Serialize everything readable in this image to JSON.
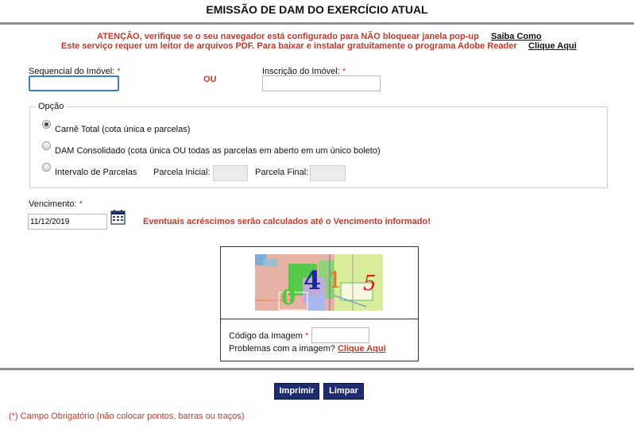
{
  "header": {
    "title": "EMISSÃO DE DAM DO EXERCÍCIO ATUAL"
  },
  "notice": {
    "popup_warning": "ATENÇÃO, verifique se o seu navegador está configurado para NÃO bloquear janela pop-up",
    "popup_link": "Saiba Como",
    "pdf_warning": "Este serviço requer um leitor de arquivos PDF. Para baixar e instalar gratuitamente o programa Adobe Reader",
    "pdf_link": "Clique Aqui"
  },
  "form": {
    "sequencial_label": "Sequencial do Imóvel:",
    "sequencial_value": "",
    "ou_label": "OU",
    "inscricao_label": "Inscrição do Imóvel:",
    "inscricao_value": "",
    "required_mark": "*"
  },
  "opcao": {
    "legend": "Opção",
    "options": [
      {
        "label": "Carnê Total (cota única e parcelas)",
        "checked": true
      },
      {
        "label": "DAM Consolidado (cota única OU todas as parcelas em aberto em um único boleto)",
        "checked": false
      },
      {
        "label": "Intervalo de Parcelas",
        "checked": false
      }
    ],
    "parcela_inicial_label": "Parcela Inicial:",
    "parcela_final_label": "Parcela Final:"
  },
  "vencimento": {
    "label": "Vencimento:",
    "value": "11/12/2019",
    "note": "Eventuais acréscimos serão calculados até o Vencimento informado!",
    "calendar_icon": "calendar-icon"
  },
  "captcha": {
    "digits": [
      "0",
      "4",
      "1",
      "5"
    ],
    "digit_colors": [
      "#4fc83a",
      "#1b2a9a",
      "#e8701a",
      "#d21f1f"
    ],
    "code_label": "Código da Imagem",
    "code_value": "",
    "problem_text": "Problemas com a imagem?",
    "problem_link": "Clique Aqui"
  },
  "actions": {
    "print_label": "Imprimir",
    "clear_label": "Limpar"
  },
  "footer": {
    "note": "(*) Campo Obrigatório (não colocar pontos, barras ou traços)"
  },
  "colors": {
    "accent_red": "#c0392b",
    "button_navy": "#1d2c6e",
    "rule_gray": "#8f8f8f"
  }
}
